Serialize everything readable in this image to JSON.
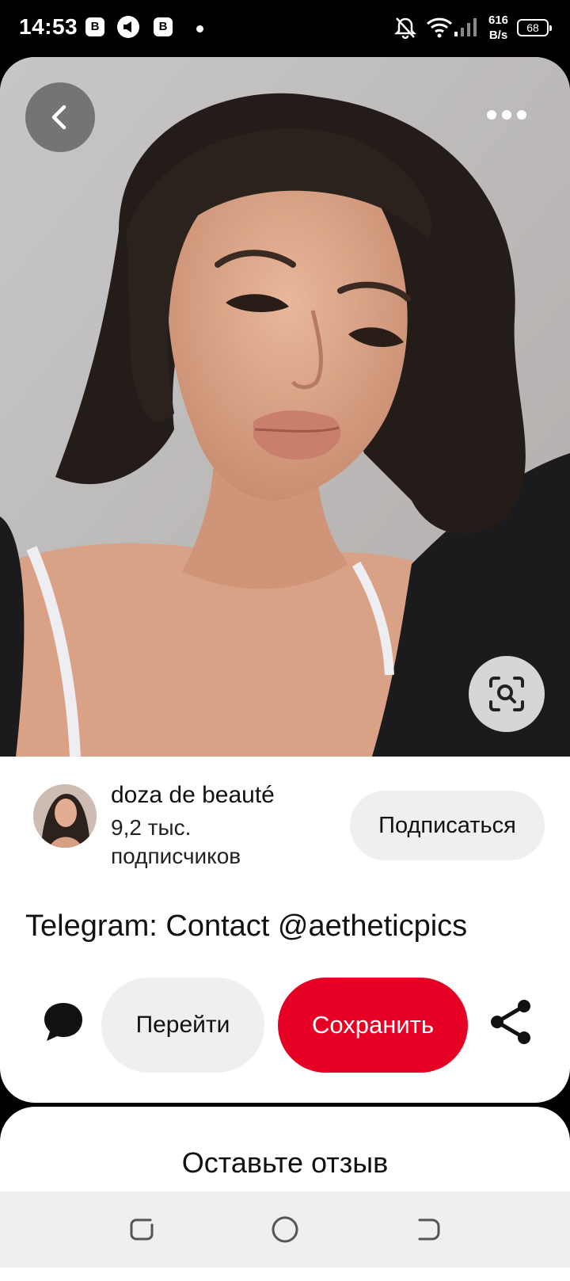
{
  "status_bar": {
    "time": "14:53",
    "notif_icons": [
      "app-b-icon",
      "megaphone-icon",
      "app-b-icon"
    ],
    "net_speed_value": "616",
    "net_speed_unit": "B/s",
    "battery": "68"
  },
  "pin": {
    "image_alt": "Портрет девушки с короткой стрижкой боб",
    "creator": {
      "name": "doza de beauté",
      "followers": "9,2 тыс. подписчиков"
    },
    "follow_label": "Подписаться",
    "title": "Telegram: Contact @aetheticpics",
    "visit_label": "Перейти",
    "save_label": "Сохранить"
  },
  "review": {
    "title": "Оставьте отзыв"
  },
  "colors": {
    "save": "#e60023",
    "secondary_button": "#efefef"
  }
}
